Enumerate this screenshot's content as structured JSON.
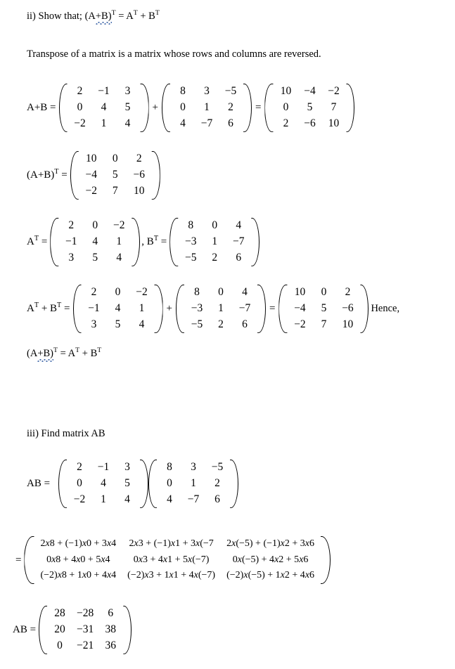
{
  "document": {
    "background_color": "#ffffff",
    "text_color": "#000000",
    "spellcheck_underline_color": "#4a6fae"
  },
  "sections": {
    "part_ii": {
      "heading_prefix": "ii) Show that; (A+B)",
      "heading_sup": "T",
      "heading_rest": " = A",
      "heading_sup2": "T",
      "heading_tail": " + B",
      "heading_sup3": "T",
      "heading_plain": "ii) Show that; (A+B)T = AT + BT",
      "definition": "Transpose of a matrix is a matrix whose rows and columns are reversed."
    },
    "part_iii": {
      "heading": "iii) Find matrix AB"
    }
  },
  "equations": {
    "a_plus_b": {
      "label": "A+B =",
      "op_plus": "+",
      "op_equals": "=",
      "matrix_a": [
        [
          "2",
          "−1",
          "3"
        ],
        [
          "0",
          "4",
          "5"
        ],
        [
          "−2",
          "1",
          "4"
        ]
      ],
      "matrix_b": [
        [
          "8",
          "3",
          "−5"
        ],
        [
          "0",
          "1",
          "2"
        ],
        [
          "4",
          "−7",
          "6"
        ]
      ],
      "result": [
        [
          "10",
          "−4",
          "−2"
        ],
        [
          "0",
          "5",
          "7"
        ],
        [
          "2",
          "−6",
          "10"
        ]
      ]
    },
    "a_plus_b_transpose": {
      "label_prefix": "(A+B)",
      "label_sup": "T",
      "label_equals": " =",
      "matrix": [
        [
          "10",
          "0",
          "2"
        ],
        [
          "−4",
          "5",
          "−6"
        ],
        [
          "−2",
          "7",
          "10"
        ]
      ]
    },
    "transposes": {
      "label_a_prefix": "A",
      "label_a_sup": "T",
      "label_a_equals": " =",
      "separator": ", B",
      "label_b_sup": "T",
      "label_b_equals": " =",
      "matrix_a_t": [
        [
          "2",
          "0",
          "−2"
        ],
        [
          "−1",
          "4",
          "1"
        ],
        [
          "3",
          "5",
          "4"
        ]
      ],
      "matrix_b_t": [
        [
          "8",
          "0",
          "4"
        ],
        [
          "−3",
          "1",
          "−7"
        ],
        [
          "−5",
          "2",
          "6"
        ]
      ]
    },
    "at_plus_bt": {
      "label_prefix": "A",
      "label_sup_a": "T",
      "label_mid": " + B",
      "label_sup_b": "T",
      "label_equals": " =",
      "op_plus": "+",
      "op_equals": "=",
      "matrix_a_t": [
        [
          "2",
          "0",
          "−2"
        ],
        [
          "−1",
          "4",
          "1"
        ],
        [
          "3",
          "5",
          "4"
        ]
      ],
      "matrix_b_t": [
        [
          "8",
          "0",
          "4"
        ],
        [
          "−3",
          "1",
          "−7"
        ],
        [
          "−5",
          "2",
          "6"
        ]
      ],
      "result": [
        [
          "10",
          "0",
          "2"
        ],
        [
          "−4",
          "5",
          "−6"
        ],
        [
          "−2",
          "7",
          "10"
        ]
      ],
      "tail_text": "Hence,"
    },
    "conclusion": {
      "prefix": "(A+B)",
      "sup": "T",
      "rest": " = A",
      "sup2": "T",
      "tail": " + B",
      "sup3": "T",
      "plain": "(A+B)T = AT + BT"
    },
    "ab_product": {
      "label": "AB =",
      "matrix_a": [
        [
          "2",
          "−1",
          "3"
        ],
        [
          "0",
          "4",
          "5"
        ],
        [
          "−2",
          "1",
          "4"
        ]
      ],
      "matrix_b": [
        [
          "8",
          "3",
          "−5"
        ],
        [
          "0",
          "1",
          "2"
        ],
        [
          "4",
          "−7",
          "6"
        ]
      ]
    },
    "ab_expansion": {
      "op_equals": "=",
      "cells": [
        [
          "2x8 + (−1)x0 + 3x4",
          "2x3 + (−1)x1 + 3x(−7",
          "2x(−5) + (−1)x2 + 3x6"
        ],
        [
          "0x8 + 4x0 + 5x4",
          "0x3 + 4x1 + 5x(−7)",
          "0x(−5) + 4x2 + 5x6"
        ],
        [
          "(−2)x8 + 1x0 + 4x4",
          "(−2)x3 + 1x1 + 4x(−7)",
          "(−2)x(−5) + 1x2 + 4x6"
        ]
      ]
    },
    "ab_result": {
      "label": "AB =",
      "matrix": [
        [
          "28",
          "−28",
          "6"
        ],
        [
          "20",
          "−31",
          "38"
        ],
        [
          "0",
          "−21",
          "36"
        ]
      ]
    }
  }
}
